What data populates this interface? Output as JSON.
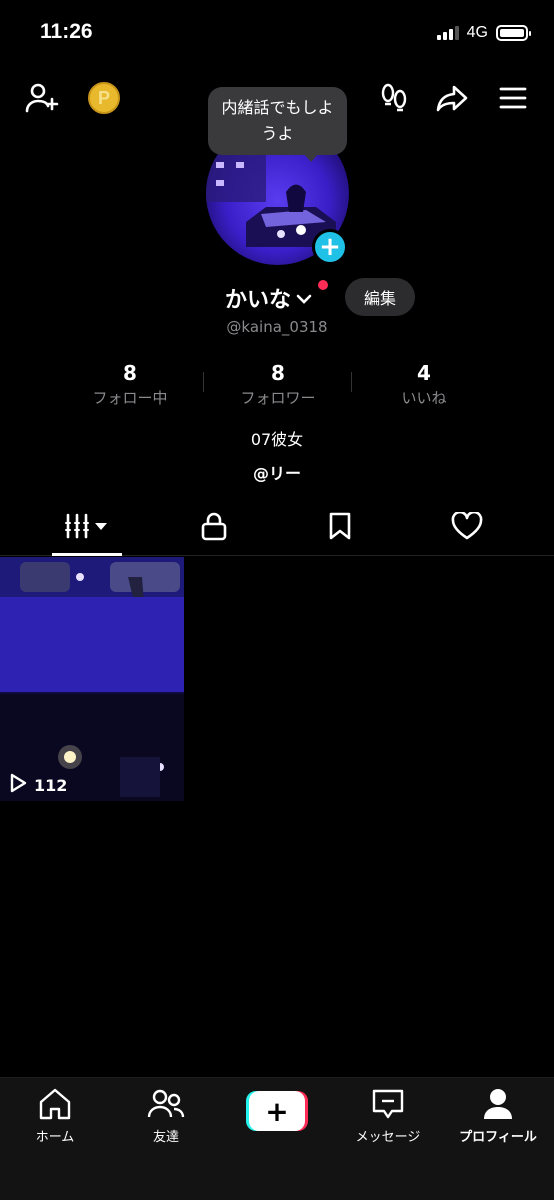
{
  "status_bar": {
    "time": "11:26",
    "network": "4G"
  },
  "top_bar": {
    "coin_letter": "P"
  },
  "bubble_text": "内緒話でもしようよ",
  "profile": {
    "name": "かいな",
    "handle": "@kaina_0318",
    "edit_label": "編集",
    "bio": "07彼女",
    "link": "@リー"
  },
  "stats": [
    {
      "value": "8",
      "label": "フォロー中"
    },
    {
      "value": "8",
      "label": "フォロワー"
    },
    {
      "value": "4",
      "label": "いいね"
    }
  ],
  "tabs": [
    "videos-grid-icon",
    "lock-icon",
    "bookmark-icon",
    "heart-icon"
  ],
  "videos": [
    {
      "views": "112"
    }
  ],
  "nav": {
    "home": "ホーム",
    "friends": "友達",
    "create": "+",
    "messages": "メッセージ",
    "profile": "プロフィール"
  },
  "colors": {
    "accent_cyan": "#20c1e6",
    "notification_red": "#ff2d55",
    "coin": "#e8b92c"
  }
}
